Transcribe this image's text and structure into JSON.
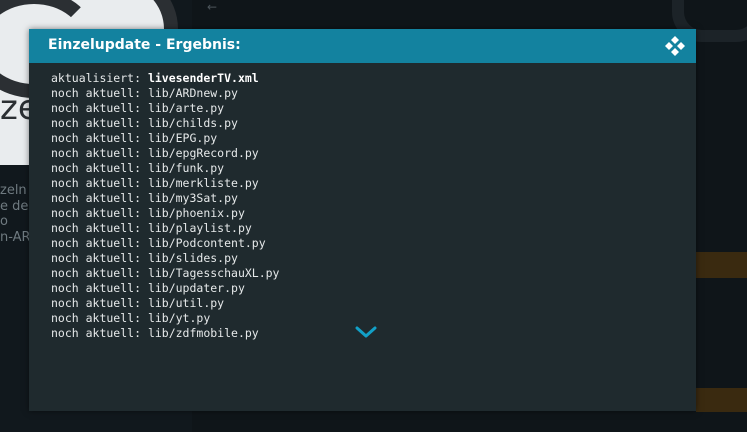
{
  "background": {
    "left_panel_letters": "ze",
    "side_text_lines": [
      "zeln",
      "e de",
      "o",
      "n-AR"
    ]
  },
  "dialog": {
    "title": "Einzelupdate - Ergebnis:",
    "lines": [
      {
        "prefix": "aktualisiert: ",
        "value": "livesenderTV.xml",
        "bold": true
      },
      {
        "prefix": "noch aktuell: ",
        "value": "lib/ARDnew.py"
      },
      {
        "prefix": "noch aktuell: ",
        "value": "lib/arte.py"
      },
      {
        "prefix": "noch aktuell: ",
        "value": "lib/childs.py"
      },
      {
        "prefix": "noch aktuell: ",
        "value": "lib/EPG.py"
      },
      {
        "prefix": "noch aktuell: ",
        "value": "lib/epgRecord.py"
      },
      {
        "prefix": "noch aktuell: ",
        "value": "lib/funk.py"
      },
      {
        "prefix": "noch aktuell: ",
        "value": "lib/merkliste.py"
      },
      {
        "prefix": "noch aktuell: ",
        "value": "lib/my3Sat.py"
      },
      {
        "prefix": "noch aktuell: ",
        "value": "lib/phoenix.py"
      },
      {
        "prefix": "noch aktuell: ",
        "value": "lib/playlist.py"
      },
      {
        "prefix": "noch aktuell: ",
        "value": "lib/Podcontent.py"
      },
      {
        "prefix": "noch aktuell: ",
        "value": "lib/slides.py"
      },
      {
        "prefix": "noch aktuell: ",
        "value": "lib/TagesschauXL.py"
      },
      {
        "prefix": "noch aktuell: ",
        "value": "lib/updater.py"
      },
      {
        "prefix": "noch aktuell: ",
        "value": "lib/util.py"
      },
      {
        "prefix": "noch aktuell: ",
        "value": "lib/yt.py"
      },
      {
        "prefix": "noch aktuell: ",
        "value": "lib/zdfmobile.py"
      }
    ]
  },
  "icons": {
    "header_logo": "kodi-logo-icon",
    "scroll_indicator": "chevron-down-icon"
  },
  "colors": {
    "header": "#13829f",
    "dialog_bg": "#1f2a2e",
    "chevron": "#12a0c7"
  }
}
